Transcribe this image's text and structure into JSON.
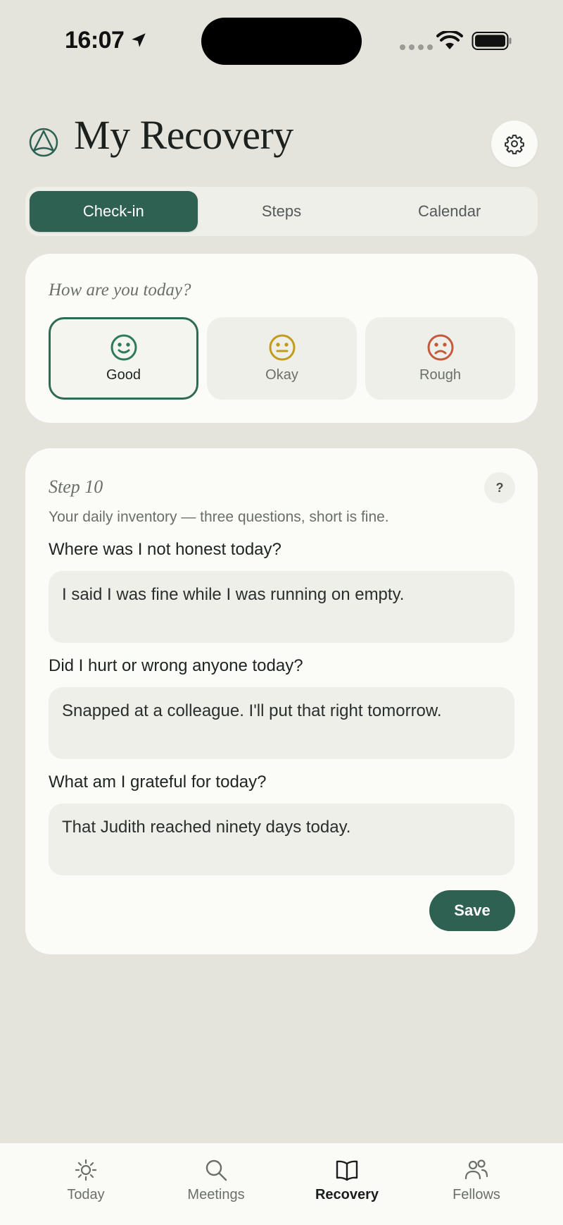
{
  "status": {
    "time": "16:07"
  },
  "header": {
    "title": "My Recovery"
  },
  "segments": [
    {
      "label": "Check-in",
      "active": true
    },
    {
      "label": "Steps",
      "active": false
    },
    {
      "label": "Calendar",
      "active": false
    }
  ],
  "mood": {
    "question": "How are you today?",
    "options": [
      {
        "label": "Good",
        "icon": "smile-icon",
        "color": "#2f7a5b",
        "selected": true
      },
      {
        "label": "Okay",
        "icon": "neutral-face-icon",
        "color": "#c29a1e",
        "selected": false
      },
      {
        "label": "Rough",
        "icon": "frown-icon",
        "color": "#c45a3c",
        "selected": false
      }
    ]
  },
  "step": {
    "title": "Step 10",
    "help": "?",
    "subtitle": "Your daily inventory — three questions, short is fine.",
    "questions": [
      {
        "label": "Where was I not honest today?",
        "answer": "I said I was fine while I was running on empty."
      },
      {
        "label": "Did I hurt or wrong anyone today?",
        "answer": "Snapped at a colleague. I'll put that right tomorrow."
      },
      {
        "label": "What am I grateful for today?",
        "answer": "That Judith reached ninety days today."
      }
    ],
    "save_label": "Save"
  },
  "tabs": [
    {
      "label": "Today",
      "icon": "sun-icon",
      "active": false
    },
    {
      "label": "Meetings",
      "icon": "search-icon",
      "active": false
    },
    {
      "label": "Recovery",
      "icon": "book-icon",
      "active": true
    },
    {
      "label": "Fellows",
      "icon": "people-icon",
      "active": false
    }
  ],
  "colors": {
    "accent": "#2e6152",
    "background": "#e4e4dd",
    "card": "#fbfbf8"
  }
}
